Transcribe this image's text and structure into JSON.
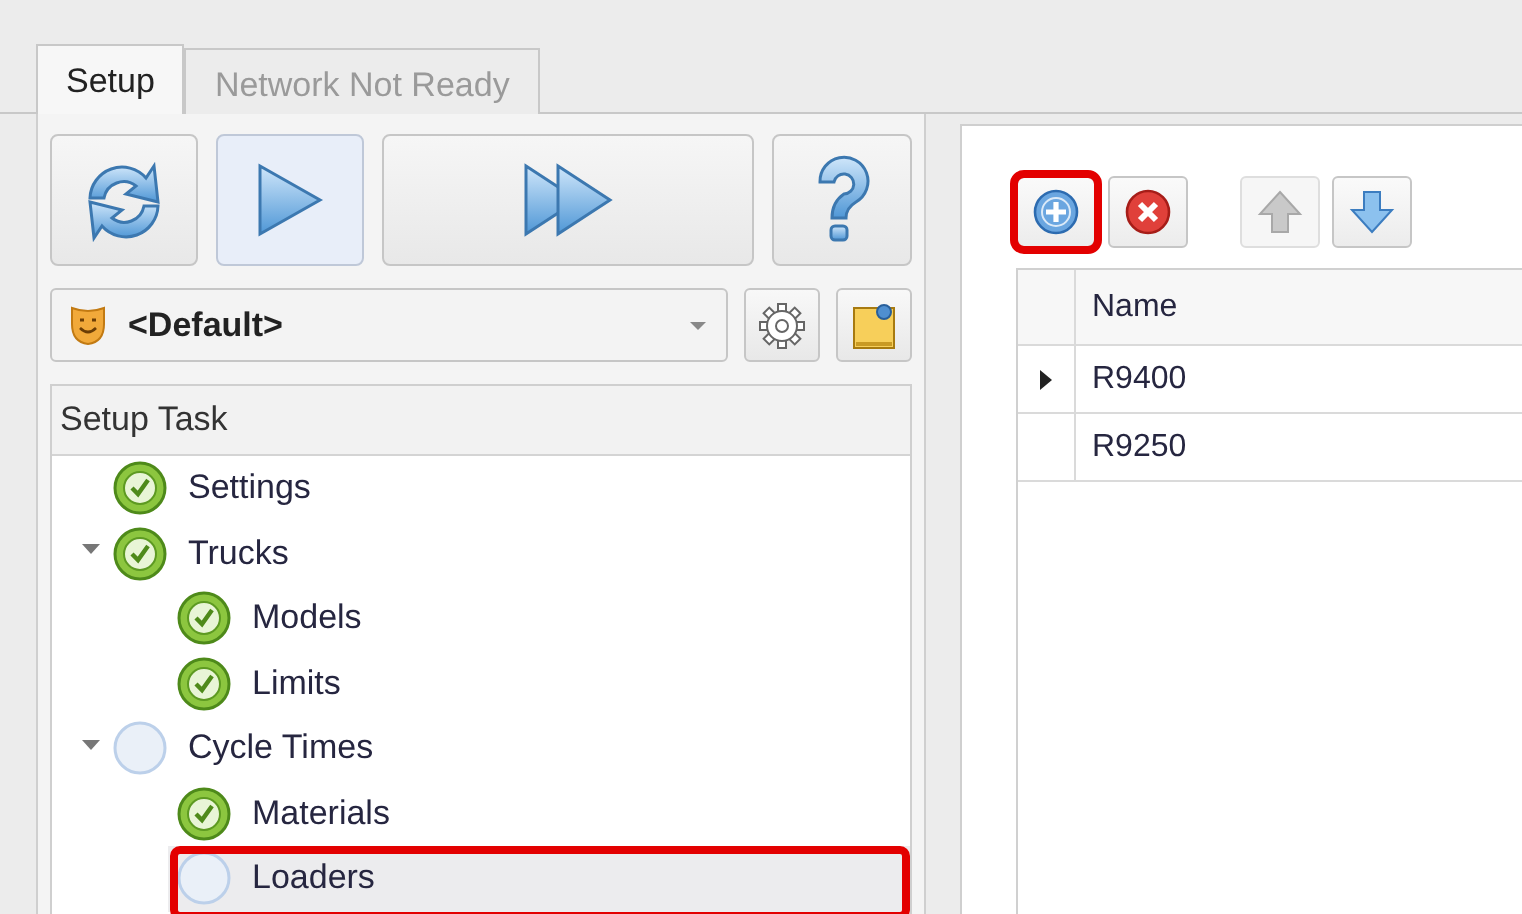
{
  "tabs": [
    {
      "label": "Setup",
      "selected": true
    },
    {
      "label": "Network Not Ready",
      "selected": false
    }
  ],
  "toolbar": {
    "buttons": [
      {
        "kind": "refresh",
        "selected": false
      },
      {
        "kind": "play",
        "selected": true
      },
      {
        "kind": "fast-forward",
        "selected": false
      },
      {
        "kind": "help",
        "selected": false
      }
    ]
  },
  "profile": {
    "value": "<Default>"
  },
  "setup_task": {
    "header": "Setup Task",
    "items": [
      {
        "label": "Settings",
        "done": true,
        "selected": false,
        "highlighted": false
      },
      {
        "label": "Trucks",
        "done": true,
        "expanded": true,
        "selected": false,
        "highlighted": false,
        "children": [
          {
            "label": "Models",
            "done": true,
            "selected": false,
            "highlighted": false
          },
          {
            "label": "Limits",
            "done": true,
            "selected": false,
            "highlighted": false
          }
        ]
      },
      {
        "label": "Cycle Times",
        "done": false,
        "expanded": true,
        "selected": false,
        "highlighted": false,
        "children": [
          {
            "label": "Materials",
            "done": true,
            "selected": false,
            "highlighted": false
          },
          {
            "label": "Loaders",
            "done": false,
            "selected": true,
            "highlighted": true
          }
        ]
      }
    ]
  },
  "grid_toolbar": [
    {
      "kind": "add",
      "disabled": false,
      "highlighted": true
    },
    {
      "kind": "delete",
      "disabled": false,
      "highlighted": false
    },
    {
      "kind": "up",
      "disabled": true,
      "highlighted": false
    },
    {
      "kind": "down",
      "disabled": false,
      "highlighted": false
    }
  ],
  "table": {
    "columns": [
      "Name"
    ],
    "rows": [
      {
        "name": "R9400",
        "current": true
      },
      {
        "name": "R9250",
        "current": false
      }
    ]
  }
}
